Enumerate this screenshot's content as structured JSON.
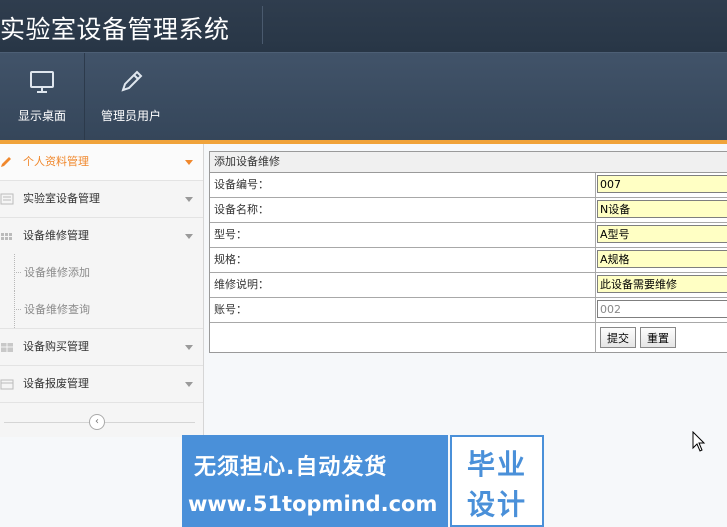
{
  "app": {
    "title": "实验室设备管理系统"
  },
  "toolbar": {
    "items": [
      {
        "label": "显示桌面",
        "icon": "monitor-icon"
      },
      {
        "label": "管理员用户",
        "icon": "pencil-icon"
      }
    ]
  },
  "sidebar": {
    "items": [
      {
        "label": "个人资料管理",
        "icon": "pencil-icon",
        "active": true
      },
      {
        "label": "实验室设备管理",
        "icon": "list-icon"
      },
      {
        "label": "设备维修管理",
        "icon": "grid-icon",
        "expanded": true,
        "children": [
          {
            "label": "设备维修添加"
          },
          {
            "label": "设备维修查询"
          }
        ]
      },
      {
        "label": "设备购买管理",
        "icon": "table-icon"
      },
      {
        "label": "设备报废管理",
        "icon": "calendar-icon"
      }
    ],
    "collapse_glyph": "‹"
  },
  "form": {
    "title": "添加设备维修",
    "fields": [
      {
        "label": "设备编号：",
        "value": "007"
      },
      {
        "label": "设备名称：",
        "value": "N设备"
      },
      {
        "label": "型号：",
        "value": "A型号"
      },
      {
        "label": "规格：",
        "value": "A规格"
      },
      {
        "label": "维修说明：",
        "value": "此设备需要维修"
      },
      {
        "label": "账号：",
        "value": "002",
        "readonly": true
      }
    ],
    "submit_label": "提交",
    "reset_label": "重置"
  },
  "banner": {
    "line1": "无须担心.自动发货",
    "line2": "www.51topmind.com",
    "right_line1": "毕业",
    "right_line2": "设计"
  },
  "colors": {
    "accent": "#f0882d",
    "header": "#35465a",
    "banner": "#4a90d9"
  }
}
